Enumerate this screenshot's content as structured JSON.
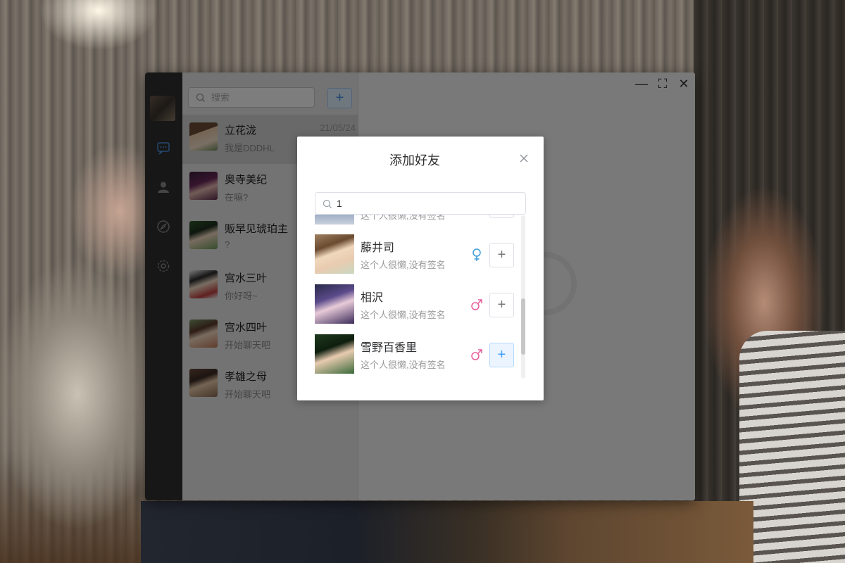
{
  "window": {
    "controls": {
      "minimize": "—",
      "maximize": "⛶",
      "close": "✕"
    }
  },
  "sidebar": {
    "search_placeholder": "搜索",
    "add_button": "+"
  },
  "conversations": [
    {
      "name": "立花泷",
      "message": "我是DDDHL",
      "time": "21/05/24",
      "active": true
    },
    {
      "name": "奥寺美纪",
      "message": "在嘛?"
    },
    {
      "name": "贩早见琥珀主",
      "message": "?"
    },
    {
      "name": "宫水三叶",
      "message": "你好呀~"
    },
    {
      "name": "宫水四叶",
      "message": "开始聊天吧"
    },
    {
      "name": "孝雄之母",
      "message": "开始聊天吧"
    }
  ],
  "dialog": {
    "title": "添加好友",
    "search_value": "1",
    "results": [
      {
        "name": "",
        "signature": "这个人很懒,没有签名",
        "gender": "",
        "add": "+"
      },
      {
        "name": "藤井司",
        "signature": "这个人很懒,没有签名",
        "gender": "female",
        "add": "+"
      },
      {
        "name": "相沢",
        "signature": "这个人很懒,没有签名",
        "gender": "male",
        "add": "+"
      },
      {
        "name": "雪野百香里",
        "signature": "这个人很懒,没有签名",
        "gender": "male",
        "add": "+"
      }
    ]
  },
  "colors": {
    "accent": "#409eff",
    "female_icon": "#3a9bdc",
    "male_icon": "#e75c9a"
  }
}
